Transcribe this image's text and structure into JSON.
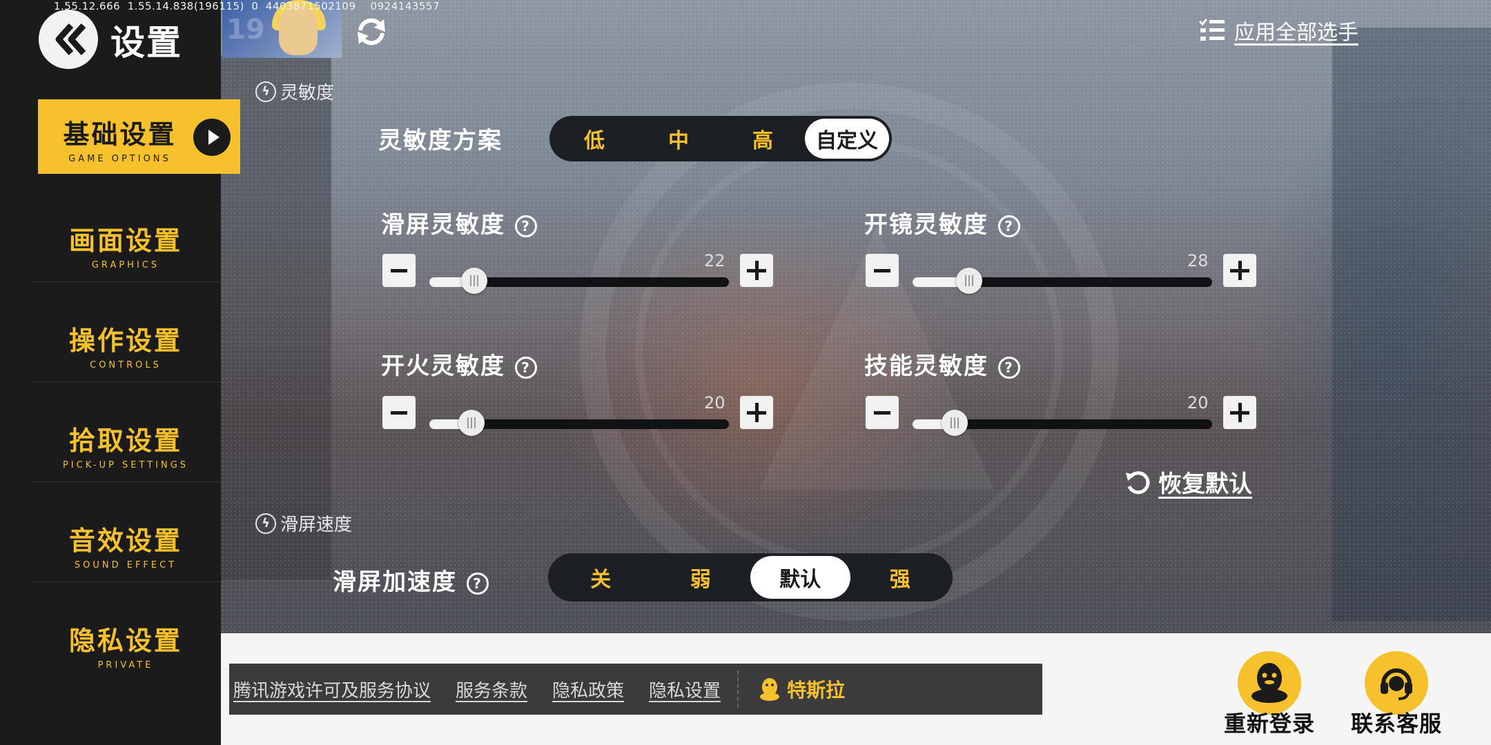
{
  "debug_text": "1.55.12.666  1.55.14.838(196115)  0  4403871502109    0924143557",
  "header": {
    "title": "设置",
    "apply_all": "应用全部选手"
  },
  "sidebar": {
    "items": [
      {
        "zh": "基础设置",
        "en": "GAME OPTIONS",
        "active": true
      },
      {
        "zh": "画面设置",
        "en": "GRAPHICS"
      },
      {
        "zh": "操作设置",
        "en": "CONTROLS"
      },
      {
        "zh": "拾取设置",
        "en": "PICK-UP SETTINGS"
      },
      {
        "zh": "音效设置",
        "en": "SOUND EFFECT"
      },
      {
        "zh": "隐私设置",
        "en": "PRIVATE"
      }
    ]
  },
  "sensitivity": {
    "section_title": "灵敏度",
    "scheme_label": "灵敏度方案",
    "scheme_options": [
      "低",
      "中",
      "高",
      "自定义"
    ],
    "scheme_selected": "自定义",
    "sliders": [
      {
        "label": "滑屏灵敏度",
        "value": "22",
        "fraction": 0.15
      },
      {
        "label": "开镜灵敏度",
        "value": "28",
        "fraction": 0.19
      },
      {
        "label": "开火灵敏度",
        "value": "20",
        "fraction": 0.14
      },
      {
        "label": "技能灵敏度",
        "value": "20",
        "fraction": 0.14
      }
    ],
    "restore_default": "恢复默认"
  },
  "swipe_speed": {
    "section_title": "滑屏速度",
    "accel_label": "滑屏加速度",
    "options": [
      "关",
      "弱",
      "默认",
      "强"
    ],
    "selected": "默认"
  },
  "footer": {
    "links": [
      "腾讯游戏许可及服务协议",
      "服务条款",
      "隐私政策",
      "隐私设置"
    ],
    "username": "特斯拉",
    "relogin": "重新登录",
    "support": "联系客服"
  },
  "colors": {
    "accent": "#f6c12c",
    "sidebar_bg": "#1b1b1b"
  }
}
